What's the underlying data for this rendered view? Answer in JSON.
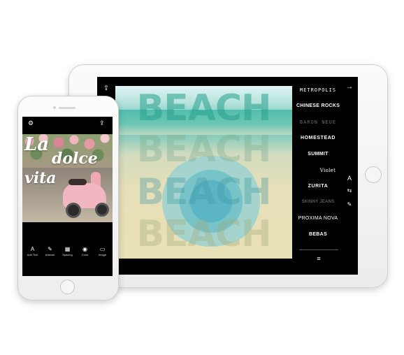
{
  "ipad": {
    "font_list": [
      "METROPOLIS",
      "CHINESE ROCKS",
      "BARON NEUE",
      "HOMESTEAD",
      "SUMMIT",
      "Violet",
      "ZURITA",
      "SKINNY JEANS",
      "PROXIMA NOVA",
      "BEBAS"
    ],
    "canvas_word": "BEACH",
    "icons": {
      "share": "⇪",
      "next": "→",
      "text_size": "A",
      "align": "⇆",
      "pen": "✎",
      "menu": "≡"
    }
  },
  "iphone": {
    "overlay_text": [
      "La",
      "dolce",
      "vita"
    ],
    "icons": {
      "settings": "⚙",
      "share": "⇪"
    },
    "tabs": [
      {
        "icon": "A",
        "label": "Add Text"
      },
      {
        "icon": "✎",
        "label": "Artwork"
      },
      {
        "icon": "▦",
        "label": "Spacing"
      },
      {
        "icon": "◉",
        "label": "Color"
      },
      {
        "icon": "▭",
        "label": "Image"
      }
    ]
  }
}
